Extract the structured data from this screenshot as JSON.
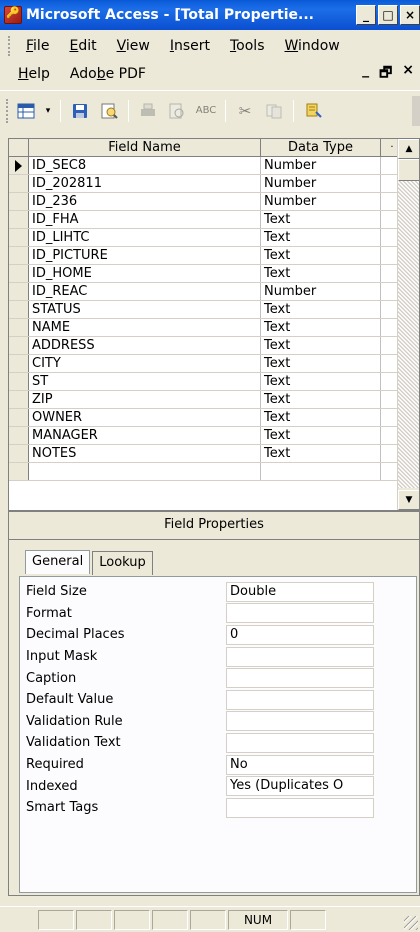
{
  "window": {
    "title": "Microsoft Access - [Total Propertie...",
    "minimize": "_",
    "maximize": "□",
    "close": "×"
  },
  "menu": {
    "row1": [
      {
        "pre": "",
        "ul": "F",
        "post": "ile"
      },
      {
        "pre": "",
        "ul": "E",
        "post": "dit"
      },
      {
        "pre": "",
        "ul": "V",
        "post": "iew"
      },
      {
        "pre": "",
        "ul": "I",
        "post": "nsert"
      },
      {
        "pre": "",
        "ul": "T",
        "post": "ools"
      },
      {
        "pre": "",
        "ul": "W",
        "post": "indow"
      }
    ],
    "row2": [
      {
        "pre": "",
        "ul": "H",
        "post": "elp"
      },
      {
        "pre": "Ado",
        "ul": "b",
        "post": "e PDF"
      }
    ],
    "mdi": [
      "_",
      "🗗",
      "×"
    ]
  },
  "grid": {
    "headers": {
      "field_name": "Field Name",
      "data_type": "Data Type",
      "description": "·"
    },
    "rows": [
      {
        "field": "ID_SEC8",
        "type": "Number"
      },
      {
        "field": "ID_202811",
        "type": "Number"
      },
      {
        "field": "ID_236",
        "type": "Number"
      },
      {
        "field": "ID_FHA",
        "type": "Text"
      },
      {
        "field": "ID_LIHTC",
        "type": "Text"
      },
      {
        "field": "ID_PICTURE",
        "type": "Text"
      },
      {
        "field": "ID_HOME",
        "type": "Text"
      },
      {
        "field": "ID_REAC",
        "type": "Number"
      },
      {
        "field": "STATUS",
        "type": "Text"
      },
      {
        "field": "NAME",
        "type": "Text"
      },
      {
        "field": "ADDRESS",
        "type": "Text"
      },
      {
        "field": "CITY",
        "type": "Text"
      },
      {
        "field": "ST",
        "type": "Text"
      },
      {
        "field": "ZIP",
        "type": "Text"
      },
      {
        "field": "OWNER",
        "type": "Text"
      },
      {
        "field": "MANAGER",
        "type": "Text"
      },
      {
        "field": "NOTES",
        "type": "Text"
      },
      {
        "field": "",
        "type": ""
      }
    ]
  },
  "field_properties": {
    "title": "Field Properties",
    "tabs": [
      "General",
      "Lookup"
    ],
    "props": [
      {
        "label": "Field Size",
        "value": "Double"
      },
      {
        "label": "Format",
        "value": ""
      },
      {
        "label": "Decimal Places",
        "value": "0"
      },
      {
        "label": "Input Mask",
        "value": ""
      },
      {
        "label": "Caption",
        "value": ""
      },
      {
        "label": "Default Value",
        "value": ""
      },
      {
        "label": "Validation Rule",
        "value": ""
      },
      {
        "label": "Validation Text",
        "value": ""
      },
      {
        "label": "Required",
        "value": "No"
      },
      {
        "label": "Indexed",
        "value": "Yes (Duplicates O"
      },
      {
        "label": "Smart Tags",
        "value": ""
      }
    ]
  },
  "status": {
    "num": "NUM"
  }
}
